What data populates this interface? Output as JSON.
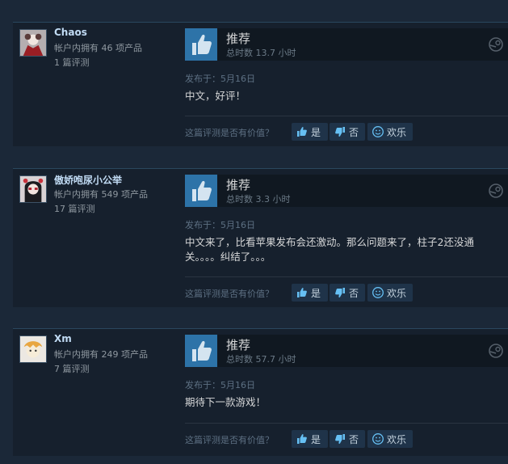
{
  "reviews": [
    {
      "user": "Chaos",
      "owned": "帐户内拥有 46 项产品",
      "review_count": "1 篇评测",
      "verdict": "推荐",
      "hours": "总时数 13.7 小时",
      "posted": "发布于：5月16日",
      "body": "中文，好评！",
      "helpful_q": "这篇评测是否有价值？",
      "yes": "是",
      "no": "否",
      "funny": "欢乐"
    },
    {
      "user": "傲娇咆尿小公举",
      "owned": "帐户内拥有 549 项产品",
      "review_count": "17 篇评测",
      "verdict": "推荐",
      "hours": "总时数 3.3 小时",
      "posted": "发布于：5月16日",
      "body": "中文来了，比看苹果发布会还激动。那么问题来了，柱子2还没通关。。。。纠结了。。。",
      "helpful_q": "这篇评测是否有价值？",
      "yes": "是",
      "no": "否",
      "funny": "欢乐"
    },
    {
      "user": "Xm",
      "owned": "帐户内拥有 249 项产品",
      "review_count": "7 篇评测",
      "verdict": "推荐",
      "hours": "总时数 57.7 小时",
      "posted": "发布于：5月16日",
      "body": "期待下一款游戏！",
      "helpful_q": "这篇评测是否有价值？",
      "yes": "是",
      "no": "否",
      "funny": "欢乐"
    }
  ],
  "icons": {
    "thumb": "thumbs-up-icon",
    "platform": "steam-icon",
    "yes": "thumbs-up-small-icon",
    "no": "thumbs-down-small-icon",
    "funny": "smiley-icon"
  },
  "colors": {
    "page_bg": "#1b2838",
    "card_bg": "#16202d",
    "thumb_bg": "#2d73a8",
    "link_blue": "#66c0f4"
  }
}
